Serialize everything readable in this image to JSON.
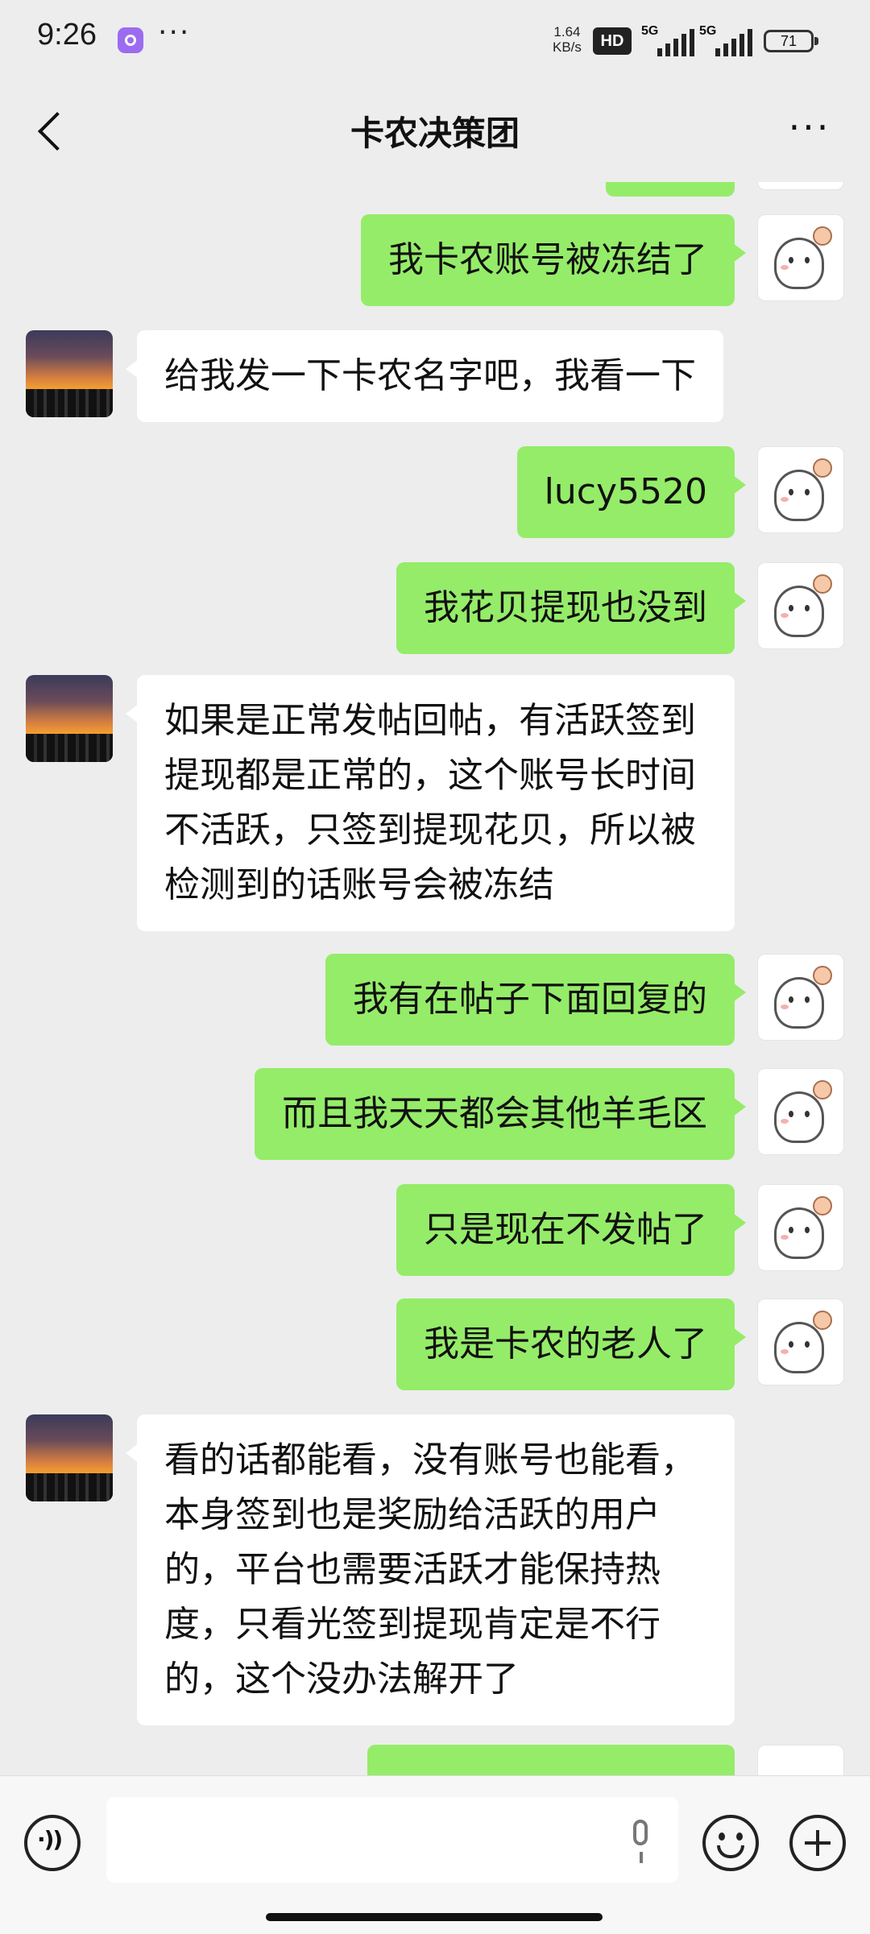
{
  "status_bar": {
    "time": "9:26",
    "more": "···",
    "net_speed_value": "1.64",
    "net_speed_unit": "KB/s",
    "hd": "HD",
    "sim1_label": "5G",
    "sim2_label": "5G",
    "battery": "71"
  },
  "header": {
    "title": "卡农决策团",
    "more": "···"
  },
  "messages": [
    {
      "side": "right",
      "text": "我卡农账号被冻结了"
    },
    {
      "side": "left",
      "text": "给我发一下卡农名字吧，我看一下"
    },
    {
      "side": "right",
      "text": "lucy5520"
    },
    {
      "side": "right",
      "text": "我花贝提现也没到"
    },
    {
      "side": "left",
      "text": "如果是正常发帖回帖，有活跃签到提现都是正常的，这个账号长时间不活跃，只签到提现花贝，所以被检测到的话账号会被冻结"
    },
    {
      "side": "right",
      "text": "我有在帖子下面回复的"
    },
    {
      "side": "right",
      "text": "而且我天天都会其他羊毛区"
    },
    {
      "side": "right",
      "text": "只是现在不发帖了"
    },
    {
      "side": "right",
      "text": "我是卡农的老人了"
    },
    {
      "side": "left",
      "text": "看的话都能看，没有账号也能看，本身签到也是奖励给活跃的用户的，平台也需要活跃才能保持热度，只看光签到提现肯定是不行的，这个没办法解开了"
    }
  ],
  "colors": {
    "background": "#ededed",
    "bubble_self": "#95ec69",
    "bubble_other": "#ffffff"
  }
}
